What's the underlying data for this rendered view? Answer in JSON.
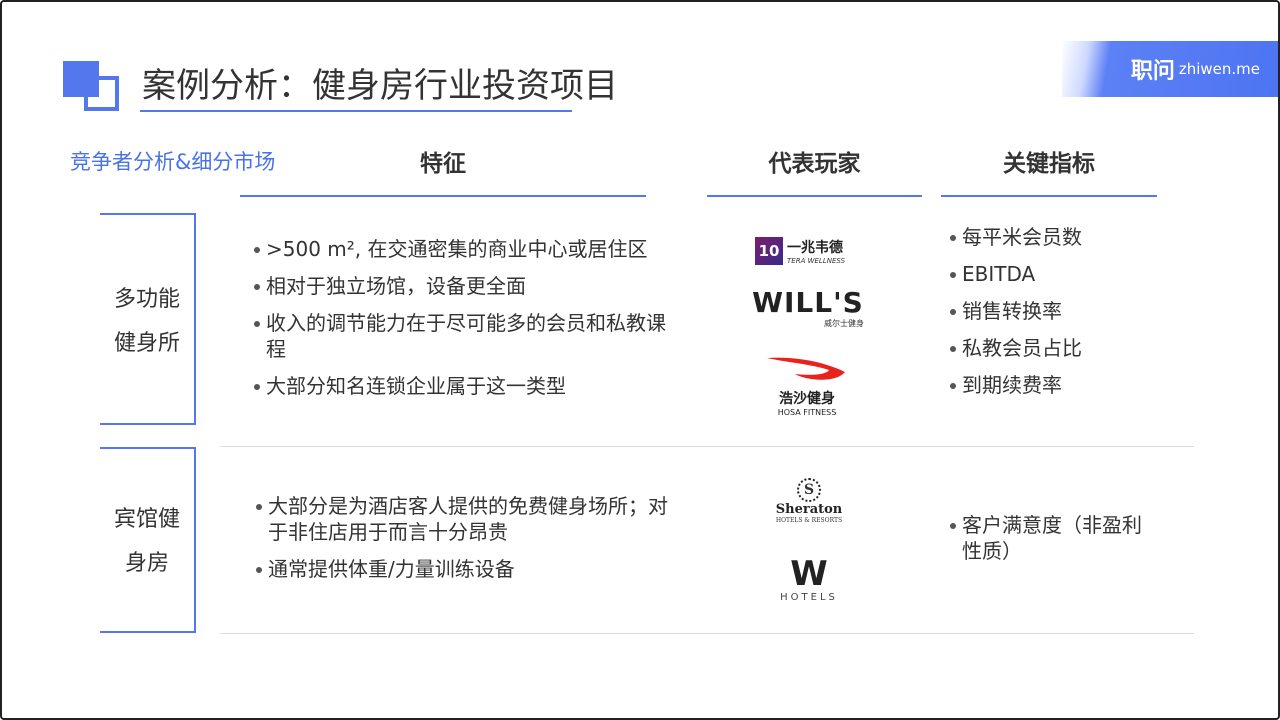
{
  "header": {
    "title": "案例分析：健身房行业投资项目",
    "brand_cn": "职问",
    "brand_en": "zhiwen.me"
  },
  "subtitle": "竞争者分析&细分市场",
  "columns": [
    "特征",
    "代表玩家",
    "关键指标"
  ],
  "rows": [
    {
      "label": [
        "多功能",
        "健身所"
      ],
      "features": [
        ">500 m², 在交通密集的商业中心或居住区",
        "相对于独立场馆，设备更全面",
        "收入的调节能力在于尽可能多的会员和私教课程",
        "大部分知名连锁企业属于这一类型"
      ],
      "players": [
        {
          "name": "一兆韦德",
          "sub": "TERA WELLNESS",
          "badge": "10"
        },
        {
          "name": "WILL'S",
          "sub": "威尔士健身"
        },
        {
          "name": "浩沙健身",
          "sub": "HOSA FITNESS"
        }
      ],
      "metrics": [
        "每平米会员数",
        "EBITDA",
        "销售转换率",
        "私教会员占比",
        "到期续费率"
      ]
    },
    {
      "label": [
        "宾馆健",
        "身房"
      ],
      "features": [
        "大部分是为酒店客人提供的免费健身场所；对于非住店用于而言十分昂贵",
        "通常提供体重/力量训练设备"
      ],
      "players": [
        {
          "name": "Sheraton",
          "sub": "HOTELS & RESORTS",
          "badge": "S"
        },
        {
          "name": "W",
          "sub": "HOTELS"
        }
      ],
      "metrics": [
        "客户满意度（非盈利性质）"
      ]
    }
  ],
  "colors": {
    "accent": "#5577ee",
    "hosa_red": "#e8231d"
  }
}
